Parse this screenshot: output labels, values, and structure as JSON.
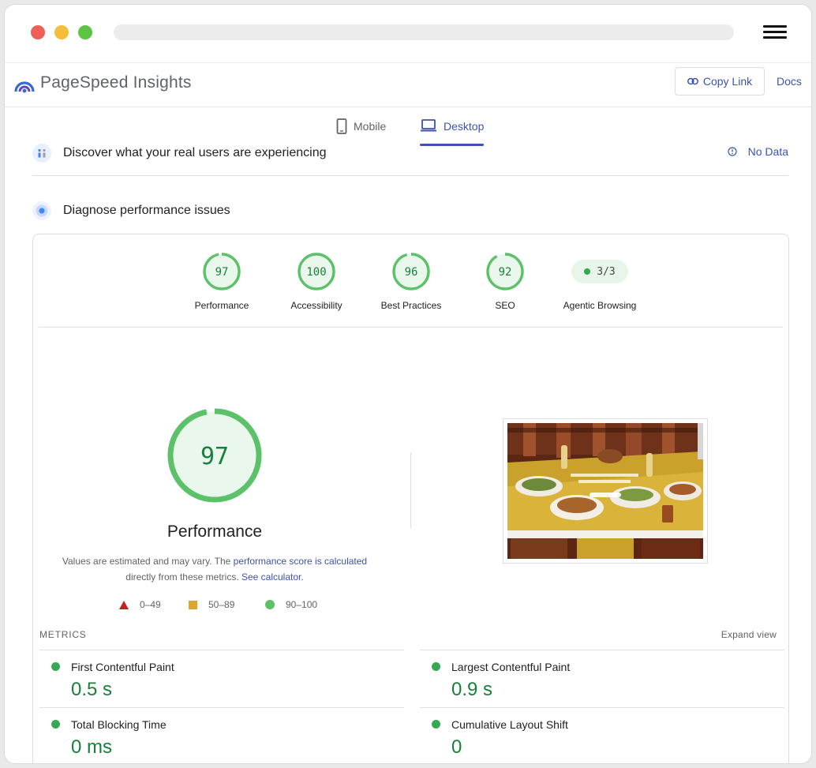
{
  "browser": {
    "url": ""
  },
  "header": {
    "title": "PageSpeed Insights",
    "copy_link": "Copy Link",
    "docs": "Docs"
  },
  "tabs": [
    {
      "label": "Mobile",
      "selected": false
    },
    {
      "label": "Desktop",
      "selected": true
    }
  ],
  "field_data": {
    "title": "Discover what your real users are experiencing",
    "status": "No Data"
  },
  "lab": {
    "title": "Diagnose performance issues"
  },
  "scores": [
    {
      "label": "Performance",
      "value": "97"
    },
    {
      "label": "Accessibility",
      "value": "100"
    },
    {
      "label": "Best Practices",
      "value": "96"
    },
    {
      "label": "SEO",
      "value": "92"
    },
    {
      "label": "Agentic Browsing",
      "value": "3/3"
    }
  ],
  "performance": {
    "score": "97",
    "label": "Performance",
    "note_prefix": "Values are estimated and may vary. The ",
    "note_link1": "performance score is calculated",
    "note_mid": "directly from these metrics. ",
    "note_link2": "See calculator."
  },
  "legend": {
    "fail": "0–49",
    "average": "50–89",
    "pass": "90–100"
  },
  "metrics": {
    "heading": "METRICS",
    "expand": "Expand view",
    "items": [
      {
        "name": "First Contentful Paint",
        "value": "0.5 s"
      },
      {
        "name": "Largest Contentful Paint",
        "value": "0.9 s"
      },
      {
        "name": "Total Blocking Time",
        "value": "0 ms"
      },
      {
        "name": "Cumulative Layout Shift",
        "value": "0"
      }
    ]
  },
  "colors": {
    "accent": "#3d52b0",
    "pass": "#0cce6b",
    "pass_text": "#188038",
    "average": "#ffa400",
    "fail": "#ff4e42"
  }
}
